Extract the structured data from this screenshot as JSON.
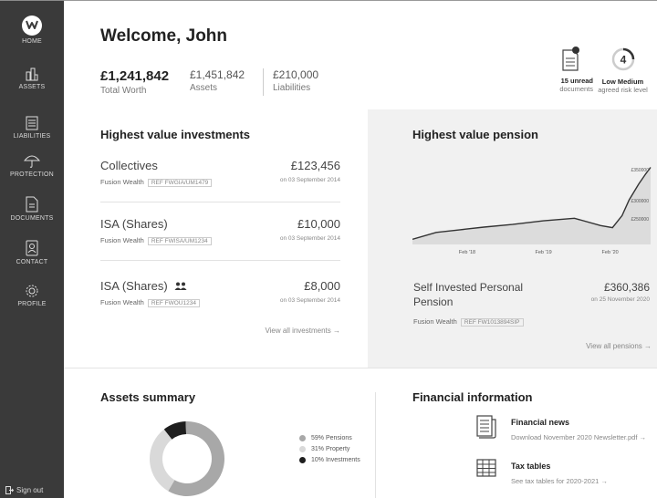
{
  "sidebar": {
    "items": [
      {
        "label": "HOME",
        "icon": "logo-icon"
      },
      {
        "label": "ASSETS",
        "icon": "assets-icon"
      },
      {
        "label": "LIABILITIES",
        "icon": "liabilities-icon"
      },
      {
        "label": "PROTECTION",
        "icon": "umbrella-icon"
      },
      {
        "label": "DOCUMENTS",
        "icon": "document-icon"
      },
      {
        "label": "CONTACT",
        "icon": "contact-icon"
      },
      {
        "label": "PROFILE",
        "icon": "gear-icon"
      }
    ],
    "signout": "Sign out"
  },
  "header": {
    "welcome": "Welcome, John",
    "total_value": "£1,241,842",
    "total_label": "Total Worth",
    "assets_value": "£1,451,842",
    "assets_label": "Assets",
    "liabilities_value": "£210,000",
    "liabilities_label": "Liabilities",
    "documents_count": "15 unread",
    "documents_label": "documents",
    "risk_number": "4",
    "risk_level": "Low Medium",
    "risk_label": "agreed risk level"
  },
  "investments": {
    "title": "Highest value investments",
    "items": [
      {
        "name": "Collectives",
        "provider": "Fusion Wealth",
        "ref": "REF FWGIA/UM1479",
        "amount": "£123,456",
        "date": "on 03 September 2014"
      },
      {
        "name": "ISA (Shares)",
        "provider": "Fusion Wealth",
        "ref": "REF FWISA/UM1234",
        "amount": "£10,000",
        "date": "on 03 September 2014"
      },
      {
        "name": "ISA (Shares)",
        "provider": "Fusion Wealth",
        "ref": "REF FWOU1234",
        "amount": "£8,000",
        "date": "on 03 September 2014"
      }
    ],
    "view_all": "View all investments →"
  },
  "pension": {
    "title": "Highest value pension",
    "name": "Self Invested Personal Pension",
    "amount": "£360,386",
    "date": "on 25 November 2020",
    "provider": "Fusion Wealth",
    "ref": "REF FW1013894SIP",
    "view_all": "View all pensions →"
  },
  "chart_data": {
    "type": "area",
    "x_ticks": [
      "Feb '18",
      "Feb '19",
      "Feb '20"
    ],
    "y_ticks": [
      "£250000",
      "£300000",
      "£350000"
    ],
    "points": [
      {
        "x": 0.0,
        "y": 225000
      },
      {
        "x": 0.1,
        "y": 238000
      },
      {
        "x": 0.2,
        "y": 243000
      },
      {
        "x": 0.3,
        "y": 248000
      },
      {
        "x": 0.42,
        "y": 253000
      },
      {
        "x": 0.55,
        "y": 260000
      },
      {
        "x": 0.68,
        "y": 265000
      },
      {
        "x": 0.79,
        "y": 251000
      },
      {
        "x": 0.84,
        "y": 247000
      },
      {
        "x": 0.88,
        "y": 270000
      },
      {
        "x": 0.91,
        "y": 300000
      },
      {
        "x": 0.95,
        "y": 330000
      },
      {
        "x": 0.98,
        "y": 350000
      },
      {
        "x": 1.0,
        "y": 362000
      }
    ],
    "ylim": [
      215000,
      375000
    ]
  },
  "assets_summary": {
    "title": "Assets summary",
    "slices": [
      {
        "label": "59% Pensions",
        "value": 59,
        "color": "#a8a8a8"
      },
      {
        "label": "31% Property",
        "value": 31,
        "color": "#d9d9d9"
      },
      {
        "label": "10% Investments",
        "value": 10,
        "color": "#1e1e1e"
      }
    ]
  },
  "financial_info": {
    "title": "Financial information",
    "items": [
      {
        "title": "Financial news",
        "subtitle": "Download November 2020 Newsletter.pdf →",
        "icon": "newspaper-icon"
      },
      {
        "title": "Tax tables",
        "subtitle": "See tax tables for 2020-2021 →",
        "icon": "table-icon"
      }
    ]
  }
}
